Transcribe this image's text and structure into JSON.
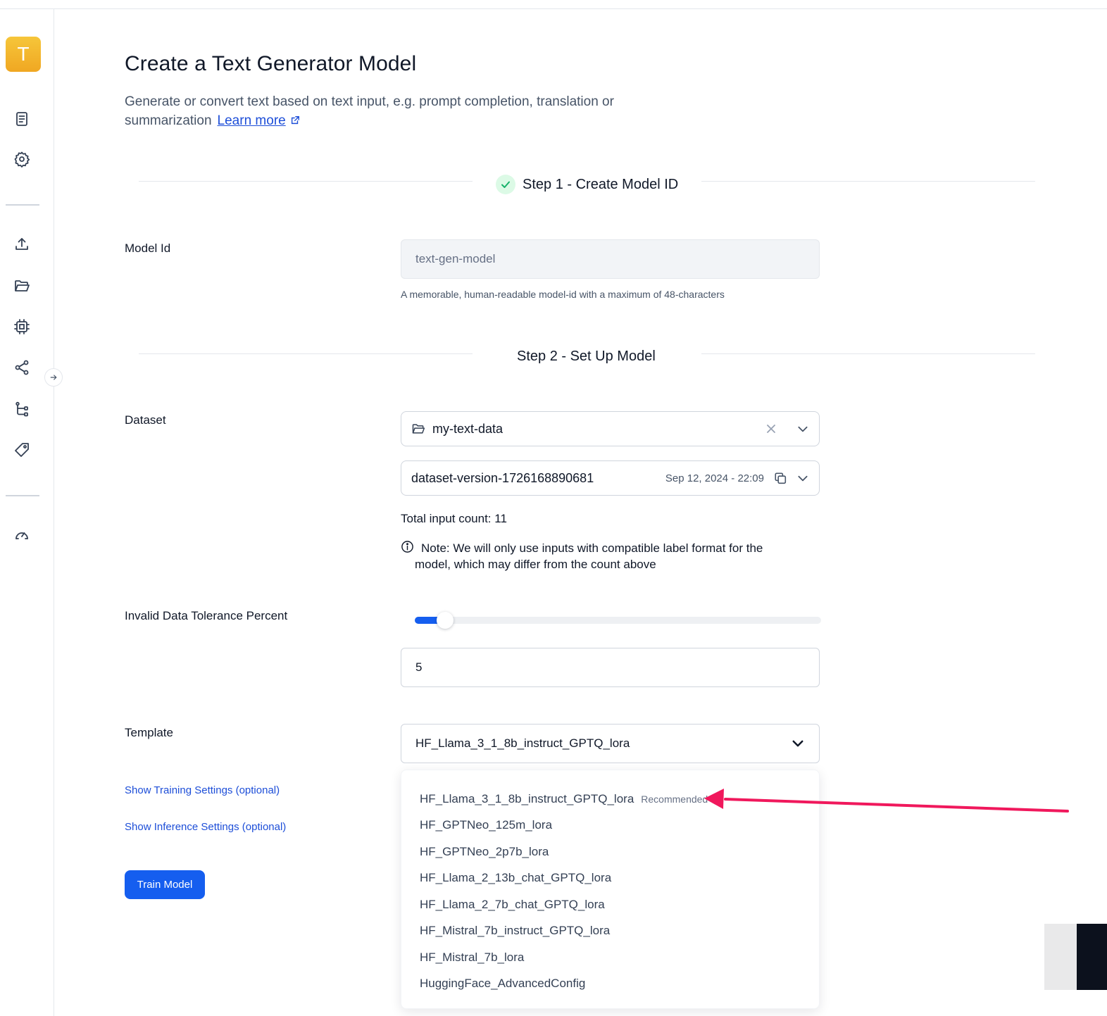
{
  "sidebar": {
    "avatar_letter": "T",
    "icons": [
      "document-icon",
      "gear-icon",
      "upload-icon",
      "folder-open-icon",
      "chip-icon",
      "share-icon",
      "workflow-icon",
      "tag-icon",
      "gauge-icon"
    ]
  },
  "header": {
    "title": "Create a Text Generator Model",
    "subtitle": "Generate or convert text based on text input, e.g. prompt completion, translation or summarization",
    "learn_more": "Learn more"
  },
  "step1": {
    "title": "Step 1 - Create Model ID",
    "model_id_label": "Model Id",
    "model_id_value": "text-gen-model",
    "model_id_help": "A memorable, human-readable model-id with a maximum of 48-characters"
  },
  "step2": {
    "title": "Step 2 - Set Up Model",
    "dataset_label": "Dataset",
    "dataset_value": "my-text-data",
    "version_value": "dataset-version-1726168890681",
    "version_date": "Sep 12, 2024 - 22:09",
    "total_count": "Total input count: 11",
    "note": "Note: We will only use inputs with compatible label format for the model, which may differ from the count above",
    "tolerance_label": "Invalid Data Tolerance Percent",
    "tolerance_value": "5",
    "tolerance_fraction": 0.05,
    "template_label": "Template",
    "template_value": "HF_Llama_3_1_8b_instruct_GPTQ_lora",
    "training_settings_link": "Show Training Settings (optional)",
    "inference_settings_link": "Show Inference Settings (optional)",
    "train_button": "Train Model"
  },
  "template_dropdown": {
    "recommended_badge": "Recommended",
    "options": [
      "HF_Llama_3_1_8b_instruct_GPTQ_lora",
      "HF_GPTNeo_125m_lora",
      "HF_GPTNeo_2p7b_lora",
      "HF_Llama_2_13b_chat_GPTQ_lora",
      "HF_Llama_2_7b_chat_GPTQ_lora",
      "HF_Mistral_7b_instruct_GPTQ_lora",
      "HF_Mistral_7b_lora",
      "HuggingFace_AdvancedConfig"
    ]
  },
  "colors": {
    "accent": "#155eef",
    "link": "#1d4ed8",
    "annotation_arrow": "#f0185c",
    "success": "#17b26a"
  }
}
